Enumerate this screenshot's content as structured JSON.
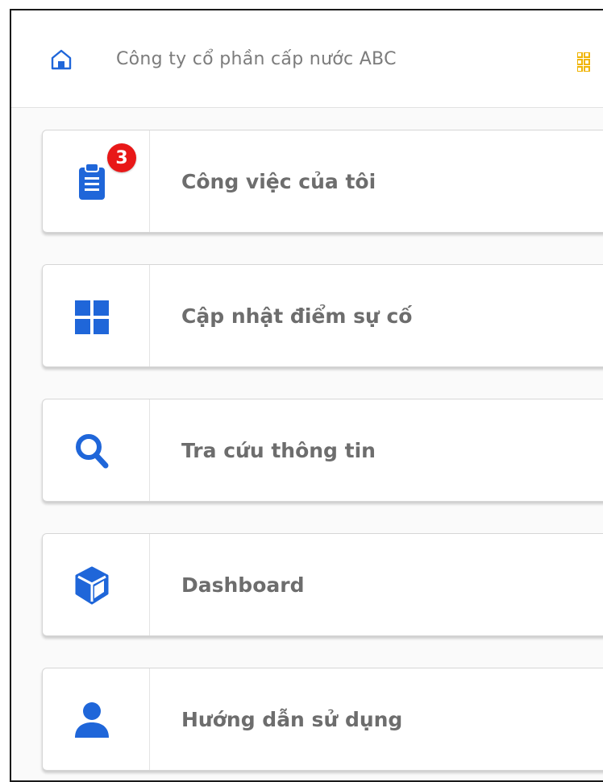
{
  "header": {
    "company_name": "Công ty cổ phần cấp nước ABC"
  },
  "menu": {
    "items": [
      {
        "label": "Công việc của tôi",
        "icon": "clipboard-icon",
        "badge": "3"
      },
      {
        "label": "Cập nhật điểm sự cố",
        "icon": "grid-icon"
      },
      {
        "label": "Tra cứu thông tin",
        "icon": "search-icon"
      },
      {
        "label": "Dashboard",
        "icon": "cube-icon"
      },
      {
        "label": "Hướng dẫn sử dụng",
        "icon": "user-icon"
      }
    ]
  },
  "colors": {
    "accent": "#1f66d9",
    "badge": "#e81818",
    "text": "#6d6d6d"
  }
}
